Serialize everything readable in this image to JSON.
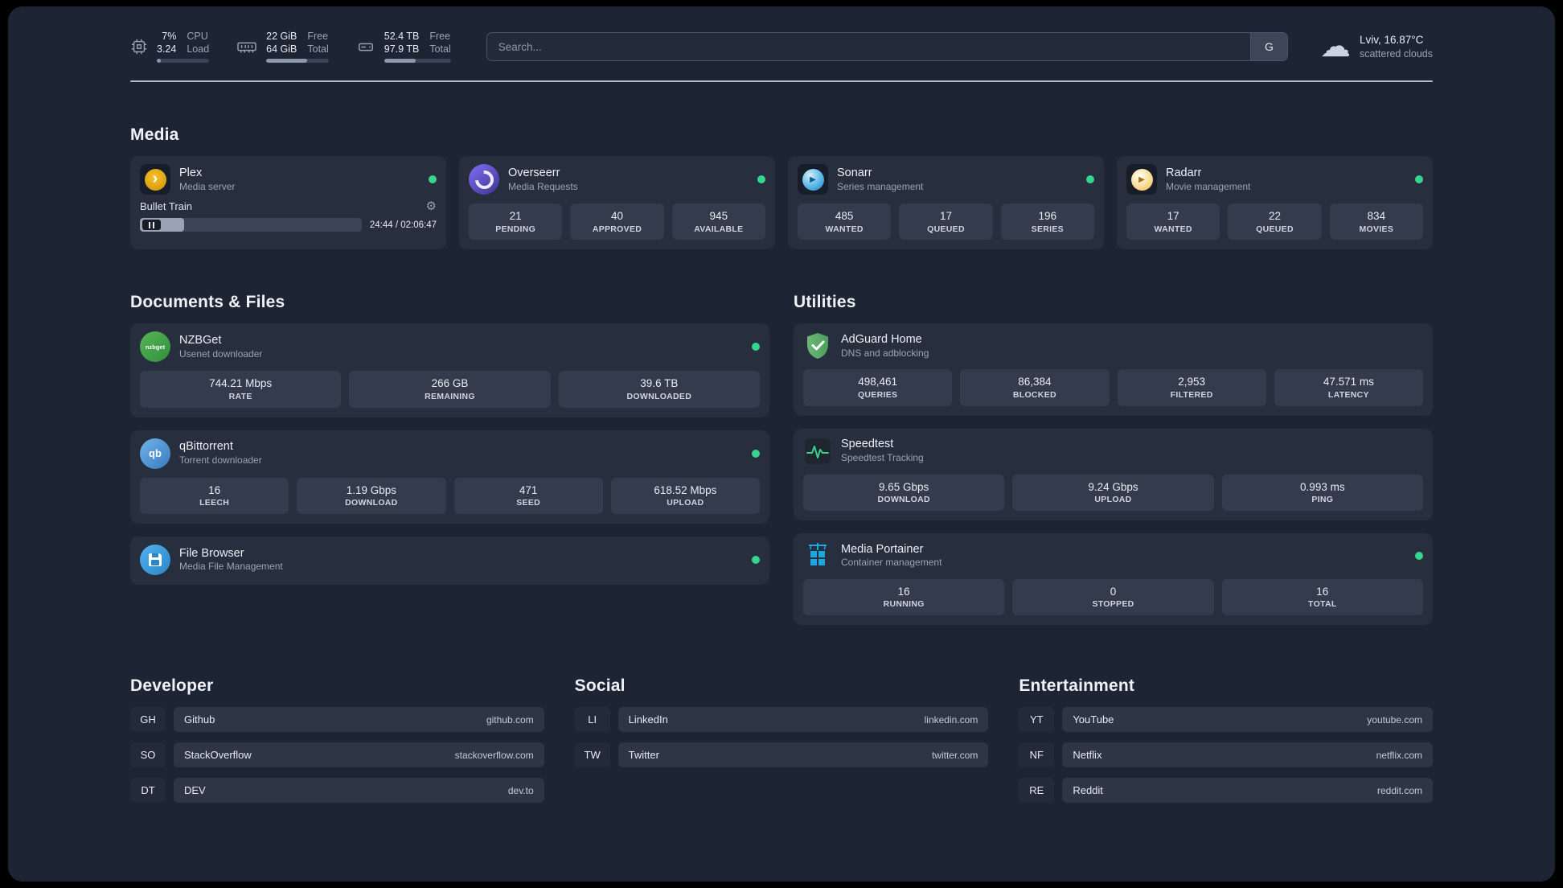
{
  "topbar": {
    "cpu": {
      "usage": "7%",
      "load_value": "3.24",
      "usage_label": "CPU",
      "load_label": "Load",
      "bar_css": "width:7%"
    },
    "memory": {
      "free_value": "22 GiB",
      "total_value": "64 GiB",
      "free_label": "Free",
      "total_label": "Total",
      "bar_css": "width:66%"
    },
    "disk": {
      "free_value": "52.4 TB",
      "total_value": "97.9 TB",
      "free_label": "Free",
      "total_label": "Total",
      "bar_css": "width:47%"
    },
    "search": {
      "placeholder": "Search...",
      "button_label": "G"
    },
    "weather": {
      "location": "Lviv, 16.87°C",
      "condition": "scattered clouds"
    }
  },
  "sections": {
    "media": {
      "title": "Media",
      "plex": {
        "name": "Plex",
        "desc": "Media server",
        "now_playing": "Bullet Train",
        "time": "24:44 / 02:06:47",
        "progress_css": "width:20%"
      },
      "overseerr": {
        "name": "Overseerr",
        "desc": "Media Requests",
        "stats": [
          {
            "value": "21",
            "label": "PENDING"
          },
          {
            "value": "40",
            "label": "APPROVED"
          },
          {
            "value": "945",
            "label": "AVAILABLE"
          }
        ]
      },
      "sonarr": {
        "name": "Sonarr",
        "desc": "Series management",
        "stats": [
          {
            "value": "485",
            "label": "WANTED"
          },
          {
            "value": "17",
            "label": "QUEUED"
          },
          {
            "value": "196",
            "label": "SERIES"
          }
        ]
      },
      "radarr": {
        "name": "Radarr",
        "desc": "Movie management",
        "stats": [
          {
            "value": "17",
            "label": "WANTED"
          },
          {
            "value": "22",
            "label": "QUEUED"
          },
          {
            "value": "834",
            "label": "MOVIES"
          }
        ]
      }
    },
    "documents": {
      "title": "Documents & Files",
      "nzbget": {
        "name": "NZBGet",
        "desc": "Usenet downloader",
        "icon_text": "nzbget",
        "stats": [
          {
            "value": "744.21 Mbps",
            "label": "RATE"
          },
          {
            "value": "266 GB",
            "label": "REMAINING"
          },
          {
            "value": "39.6 TB",
            "label": "DOWNLOADED"
          }
        ]
      },
      "qbittorrent": {
        "name": "qBittorrent",
        "desc": "Torrent downloader",
        "icon_text": "qb",
        "stats": [
          {
            "value": "16",
            "label": "LEECH"
          },
          {
            "value": "1.19 Gbps",
            "label": "DOWNLOAD"
          },
          {
            "value": "471",
            "label": "SEED"
          },
          {
            "value": "618.52 Mbps",
            "label": "UPLOAD"
          }
        ]
      },
      "filebrowser": {
        "name": "File Browser",
        "desc": "Media File Management"
      }
    },
    "utilities": {
      "title": "Utilities",
      "adguard": {
        "name": "AdGuard Home",
        "desc": "DNS and adblocking",
        "stats": [
          {
            "value": "498,461",
            "label": "QUERIES"
          },
          {
            "value": "86,384",
            "label": "BLOCKED"
          },
          {
            "value": "2,953",
            "label": "FILTERED"
          },
          {
            "value": "47.571 ms",
            "label": "LATENCY"
          }
        ]
      },
      "speedtest": {
        "name": "Speedtest",
        "desc": "Speedtest Tracking",
        "stats": [
          {
            "value": "9.65 Gbps",
            "label": "DOWNLOAD"
          },
          {
            "value": "9.24 Gbps",
            "label": "UPLOAD"
          },
          {
            "value": "0.993 ms",
            "label": "PING"
          }
        ]
      },
      "portainer": {
        "name": "Media Portainer",
        "desc": "Container management",
        "stats": [
          {
            "value": "16",
            "label": "RUNNING"
          },
          {
            "value": "0",
            "label": "STOPPED"
          },
          {
            "value": "16",
            "label": "TOTAL"
          }
        ]
      }
    },
    "developer": {
      "title": "Developer",
      "links": [
        {
          "abbr": "GH",
          "name": "Github",
          "url": "github.com"
        },
        {
          "abbr": "SO",
          "name": "StackOverflow",
          "url": "stackoverflow.com"
        },
        {
          "abbr": "DT",
          "name": "DEV",
          "url": "dev.to"
        }
      ]
    },
    "social": {
      "title": "Social",
      "links": [
        {
          "abbr": "LI",
          "name": "LinkedIn",
          "url": "linkedin.com"
        },
        {
          "abbr": "TW",
          "name": "Twitter",
          "url": "twitter.com"
        }
      ]
    },
    "entertainment": {
      "title": "Entertainment",
      "links": [
        {
          "abbr": "YT",
          "name": "YouTube",
          "url": "youtube.com"
        },
        {
          "abbr": "NF",
          "name": "Netflix",
          "url": "netflix.com"
        },
        {
          "abbr": "RE",
          "name": "Reddit",
          "url": "reddit.com"
        }
      ]
    }
  },
  "colors": {
    "background": "#1d2534",
    "card": "#272f3f",
    "stat_box": "#333b4c",
    "status_green": "#36d58e"
  }
}
